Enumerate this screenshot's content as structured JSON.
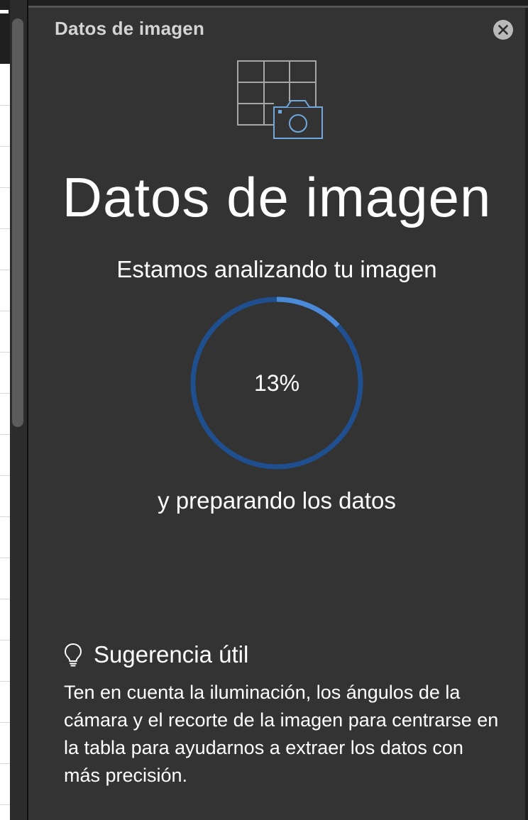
{
  "pane": {
    "title": "Datos de imagen",
    "close_icon": "close-icon"
  },
  "hero": {
    "icon": "table-camera-icon",
    "title": "Datos de imagen",
    "subtitle": "Estamos analizando tu imagen",
    "caption": "y preparando los datos"
  },
  "progress": {
    "value": 0.13,
    "label": "13%",
    "track_color": "#1f4f8f",
    "fill_color": "#4a8ad8"
  },
  "tip": {
    "icon": "lightbulb-icon",
    "title": "Sugerencia útil",
    "body": "Ten en cuenta la iluminación, los ángulos de la cámara y el recorte de la imagen para centrarse en la tabla para ayudarnos a extraer los datos con más precisión."
  },
  "colors": {
    "pane_bg": "#333333",
    "accent": "#4a8ad8"
  }
}
